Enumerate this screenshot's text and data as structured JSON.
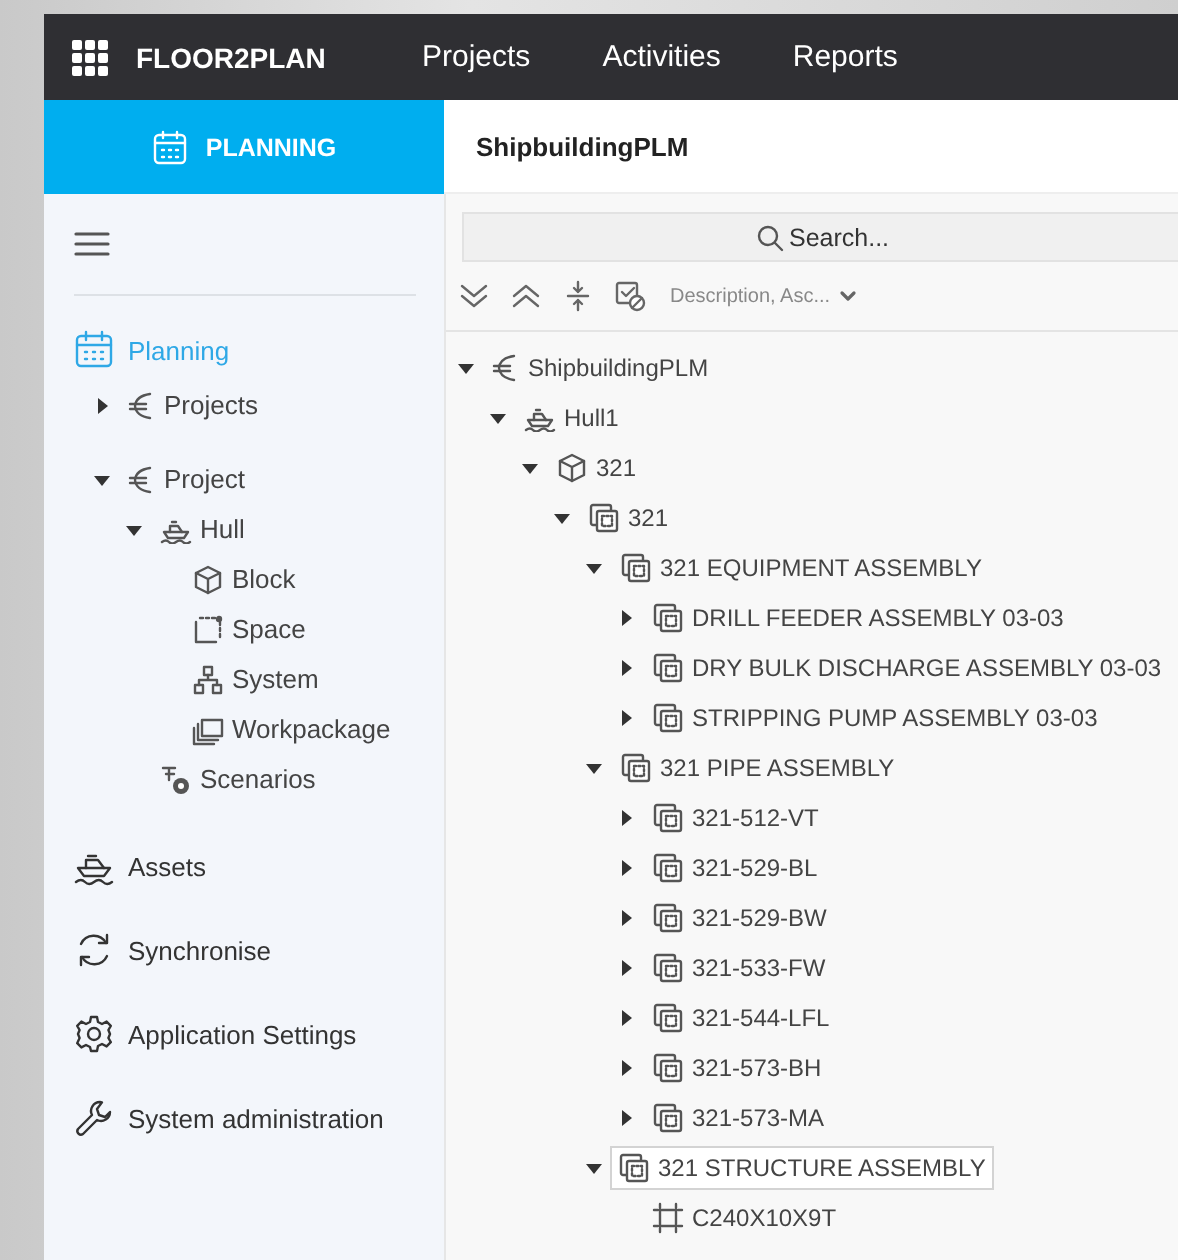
{
  "app": {
    "name": "FLOOR2PLAN",
    "menu": [
      {
        "label": "Projects"
      },
      {
        "label": "Activities"
      },
      {
        "label": "Reports"
      }
    ]
  },
  "module": {
    "label": "PLANNING"
  },
  "breadcrumb": "ShipbuildingPLM",
  "sidebar": {
    "items": [
      {
        "label": "Planning",
        "kind": "planning",
        "selected": true,
        "tree_groups": [
          {
            "nodes": [
              {
                "label": "Projects",
                "kind": "project",
                "expanded": false
              }
            ]
          },
          {
            "nodes": [
              {
                "label": "Project",
                "kind": "project",
                "expanded": true,
                "children": [
                  {
                    "label": "Hull",
                    "kind": "hull",
                    "expanded": true,
                    "children": [
                      {
                        "label": "Block",
                        "kind": "block"
                      },
                      {
                        "label": "Space",
                        "kind": "space"
                      },
                      {
                        "label": "System",
                        "kind": "system"
                      },
                      {
                        "label": "Workpackage",
                        "kind": "workpackage"
                      }
                    ]
                  },
                  {
                    "label": "Scenarios",
                    "kind": "scenarios"
                  }
                ]
              }
            ]
          }
        ]
      },
      {
        "label": "Assets",
        "kind": "assets",
        "selected": false
      },
      {
        "label": "Synchronise",
        "kind": "sync",
        "selected": false
      },
      {
        "label": "Application Settings",
        "kind": "settings",
        "selected": false
      },
      {
        "label": "System administration",
        "kind": "admin",
        "selected": false
      }
    ]
  },
  "search": {
    "placeholder": "Search..."
  },
  "sort": {
    "value": "Description, Asc..."
  },
  "tree": [
    {
      "label": "ShipbuildingPLM",
      "kind": "project",
      "expanded": true,
      "selected": false,
      "children": [
        {
          "label": "Hull1",
          "kind": "hull",
          "expanded": true,
          "selected": false,
          "children": [
            {
              "label": "321",
              "kind": "block",
              "expanded": true,
              "selected": false,
              "children": [
                {
                  "label": "321",
                  "kind": "assembly",
                  "expanded": true,
                  "selected": false,
                  "children": [
                    {
                      "label": "321 EQUIPMENT ASSEMBLY",
                      "kind": "assembly",
                      "expanded": true,
                      "selected": false,
                      "children": [
                        {
                          "label": "DRILL FEEDER ASSEMBLY 03-03",
                          "kind": "assembly",
                          "expanded": false,
                          "selected": false
                        },
                        {
                          "label": "DRY BULK DISCHARGE ASSEMBLY 03-03",
                          "kind": "assembly",
                          "expanded": false,
                          "selected": false
                        },
                        {
                          "label": "STRIPPING PUMP ASSEMBLY 03-03",
                          "kind": "assembly",
                          "expanded": false,
                          "selected": false
                        }
                      ]
                    },
                    {
                      "label": "321 PIPE ASSEMBLY",
                      "kind": "assembly",
                      "expanded": true,
                      "selected": false,
                      "children": [
                        {
                          "label": "321-512-VT",
                          "kind": "assembly",
                          "expanded": false,
                          "selected": false
                        },
                        {
                          "label": "321-529-BL",
                          "kind": "assembly",
                          "expanded": false,
                          "selected": false
                        },
                        {
                          "label": "321-529-BW",
                          "kind": "assembly",
                          "expanded": false,
                          "selected": false
                        },
                        {
                          "label": "321-533-FW",
                          "kind": "assembly",
                          "expanded": false,
                          "selected": false
                        },
                        {
                          "label": "321-544-LFL",
                          "kind": "assembly",
                          "expanded": false,
                          "selected": false
                        },
                        {
                          "label": "321-573-BH",
                          "kind": "assembly",
                          "expanded": false,
                          "selected": false
                        },
                        {
                          "label": "321-573-MA",
                          "kind": "assembly",
                          "expanded": false,
                          "selected": false
                        }
                      ]
                    },
                    {
                      "label": "321 STRUCTURE ASSEMBLY",
                      "kind": "assembly",
                      "expanded": true,
                      "selected": true,
                      "children": [
                        {
                          "label": "C240X10X9T",
                          "kind": "part",
                          "selected": false
                        }
                      ]
                    }
                  ]
                }
              ]
            }
          ]
        }
      ]
    }
  ]
}
